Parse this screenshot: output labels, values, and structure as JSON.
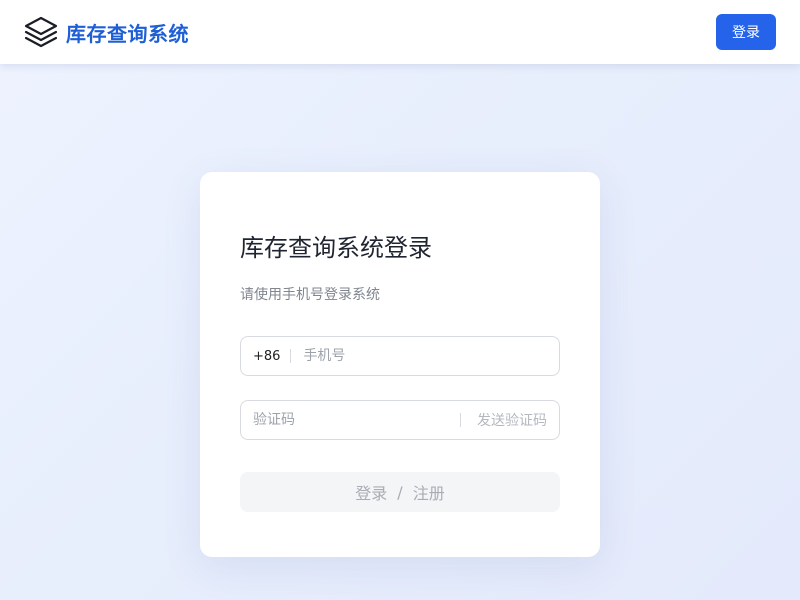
{
  "header": {
    "title": "库存查询系统",
    "login_button": "登录",
    "logo_icon": "layers-icon"
  },
  "card": {
    "title": "库存查询系统登录",
    "subtitle": "请使用手机号登录系统",
    "phone": {
      "prefix": "+86",
      "placeholder": "手机号",
      "value": ""
    },
    "code": {
      "placeholder": "验证码",
      "value": "",
      "send_label": "发送验证码"
    },
    "submit": {
      "login": "登录",
      "separator": "/",
      "register": "注册"
    }
  },
  "colors": {
    "brand": "#1f5fd6",
    "primary_button": "#2563eb",
    "disabled_button_bg": "#f4f5f7"
  }
}
